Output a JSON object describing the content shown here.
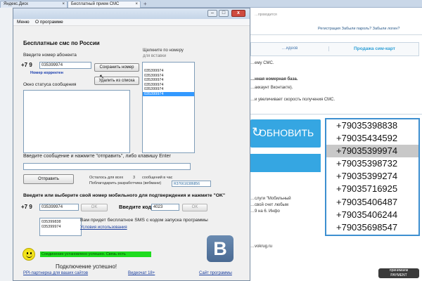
{
  "browser": {
    "tabs": [
      {
        "label": "Яндекс.Диск"
      },
      {
        "label": "Бесплатный прием СМС"
      }
    ],
    "new_tab": "+",
    "close": "×"
  },
  "website": {
    "top_note": "…проводится",
    "top_links": "Регистрация  Забыли пароль?  Забыли логин?",
    "tab_left": "…идеов",
    "tab_right": "Продажа сим-карт",
    "text_lines": [
      {
        "text": "…ему СМС.",
        "bold": false
      },
      {
        "text": "…нная номерная база.",
        "bold": true
      },
      {
        "text": "…аккаунт Вконтакте).",
        "bold": false
      },
      {
        "text": "…и увеличивает скорость получения СМС.",
        "bold": false
      }
    ],
    "refresh_button": "ОБНОВИТЬ",
    "numbers": [
      "+79035398838",
      "+79035434592",
      "+79035399974",
      "+79035398732",
      "+79035399274",
      "+79035716925",
      "+79035406487",
      "+79035406244",
      "+79035698547"
    ],
    "highlighted_number_index": 2,
    "sms_text": [
      "…слуги \"Мобильный",
      "…свой счет любым",
      "…9 на 6. Инфо"
    ],
    "vokrug": "…vokrug.ru",
    "watermark": "принимаем\nPAYMENT"
  },
  "dialog": {
    "window_buttons": {
      "minimize": "–",
      "maximize": "□",
      "close": "x"
    },
    "menu": [
      "Меню",
      "О программе"
    ],
    "heading": "Бесплатные смс по России",
    "enter_number_label": "Введите номер абонента",
    "country_code": "+7 9",
    "number_value": "035399974",
    "number_ok": "Номер корректен",
    "save_number_button": "Сохранить номер",
    "delete_from_list_button": "Удалить из списка",
    "click_number_label": "Щелкните по номеру",
    "for_insert_label": "для вставки",
    "saved_numbers": [
      "035399974",
      "035399974",
      "035399974",
      "035399974",
      "035399974",
      "035399974"
    ],
    "selected_saved_index": 5,
    "status_window_label": "Окно статуса сообщения",
    "message_label": "Введите сообщение и нажмите \"отправить\", либо клавишу Enter",
    "message_value": "",
    "send_button": "Отправить",
    "remaining_label": "Осталось для всех",
    "remaining_count": "3",
    "per_hour_label": "сообщений в час",
    "thank_label": "Поблагодарить разработчика (вебмани)",
    "webmoney_wallet": "R376616386856",
    "confirm_heading": "Введите или выберите свой номер мобильного для подтверждения и нажмите \"OK\"",
    "confirm_country": "+7 9",
    "confirm_number": "035399974",
    "ok_button": "OK",
    "code_label": "Введите код",
    "code_value": "4023",
    "ok_button_2": "OK",
    "sms_code_note": "Вам придет бесплатное SMS с кодом запуска программы",
    "terms_link": "Условия использования",
    "mini_list": [
      "035399838",
      "035399974"
    ],
    "connection_status": "Соединение установлено успешно. Связь есть",
    "success_text": "Подключение успешно!",
    "footer_links": [
      "PPI-партнерка для ваших сайтов",
      "Видеочат 18+",
      "Сайт программы"
    ],
    "vk_letter": "B"
  },
  "colors": {
    "accent_blue": "#35a6e2",
    "status_green": "#1fdc1f",
    "selection_blue": "#3399ff",
    "vk_blue": "#5a7ba4"
  }
}
